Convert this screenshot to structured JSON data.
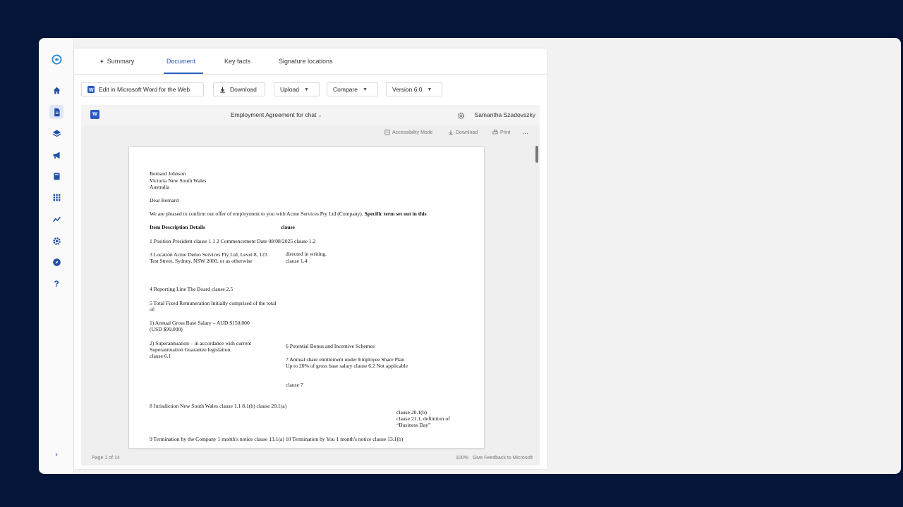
{
  "tabs": {
    "summary": "Summary",
    "document": "Document",
    "key_facts": "Key facts",
    "signature_locations": "Signature locations"
  },
  "toolbar": {
    "edit_word": "Edit in Microsoft Word for the Web",
    "download": "Download",
    "upload": "Upload",
    "compare": "Compare",
    "version": "Version 6.0"
  },
  "viewer": {
    "doc_title": "Employment Agreement for chat",
    "user_name": "Samantha Szadovszky",
    "accessibility": "Accessibility Mode",
    "download": "Download",
    "print": "Print",
    "more": "···",
    "page_indicator": "Page 1 of 14",
    "zoom": "100%",
    "feedback": "Give Feedback to Microsoft"
  },
  "document": {
    "addr1": "Bernard Johnson",
    "addr2": "Victoria New South Wales",
    "addr3": "Australia",
    "greeting": "Dear Bernard",
    "intro": "We are pleased to confirm our offer of employment to you with Acme Services Pty Ltd (Company).",
    "intro_bold": "Specific term set out in this",
    "header_item": "Item Description Details",
    "header_clause": "clause",
    "row1": "1 Position President clause 1.1 2 Commencement Date 08/08/2025 clause 1.2",
    "row3a": "3 Location Acme Demo Services Pty Ltd, Level 8, 123",
    "row3b": "Test Street, Sydney, NSW 2000, or as otherwise",
    "row3c": "directed in writing.",
    "row3d": "clause 1.4",
    "row4": "4 Reporting Line The Board clause 2.5",
    "row5a": "5 Total Fixed Remuneration Initially comprised of the total",
    "row5b": "of:",
    "row5c": "1) Annual Gross Base Salary – AUD $150,000",
    "row5d": "(USD $99,000)",
    "row5e": "2) Superannuation – in accordance with current",
    "row5f": "Superannuation Guarantee legislation.",
    "row5g": "clause 6.1",
    "row6": "6 Potential Bonus and Incentive Schemes",
    "row7a": "7 Annual share entitlement under Employee Share Plan",
    "row7b": "Up to 20% of gross base salary clause 6.2 Not applicable",
    "row7c": "clause 7",
    "row8": "8 Jurisdiction New South Wales clause 1.1 8.1(b) clause 20.1(a)",
    "row8b": "clause 20.1(b)",
    "row8c": "clause 21.1, definition of",
    "row8d": "“Business Day”",
    "row9": "9 Termination by the Company 1 month's notice clause 13.1(a) 10 Termination by You 1 month's notice clause 13.1(b)"
  },
  "colors": {
    "background": "#041537",
    "accent": "#2b5dbf",
    "word_blue": "#2b5bbf"
  },
  "icons": [
    "logo-icon",
    "home-icon",
    "document-icon",
    "layers-icon",
    "megaphone-icon",
    "book-icon",
    "grid-icon",
    "chart-icon",
    "settings-icon",
    "compass-icon",
    "help-icon",
    "expand-icon"
  ]
}
